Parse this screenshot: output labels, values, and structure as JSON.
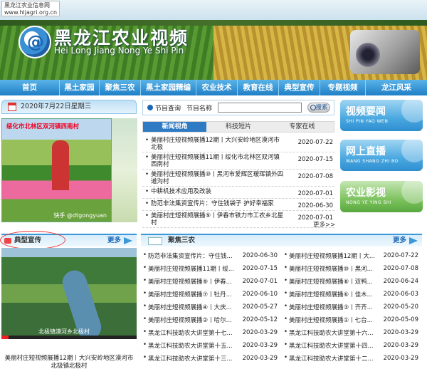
{
  "site": {
    "url_name": "黑龙江农业信息网",
    "url": "www.hljagri.org.cn",
    "logo_glyph": "@",
    "title": "黑龙江农业视频",
    "subtitle": "Hei Long Jiang Nong Ye Shi Pin"
  },
  "nav": [
    "首页",
    "黑土家园",
    "聚焦三农",
    "黑土家园精编",
    "农业技术",
    "教育在线",
    "典型宣传",
    "专题视频",
    "龙江风采"
  ],
  "date_bar": "2020年7月22日星期三",
  "photo1": {
    "caption": "绥化市北林区双河镇西南村",
    "watermark": "快手 @dtgongyuan"
  },
  "search": {
    "radio_label": "节目查询",
    "name_label": "节目名称",
    "value": "",
    "button": "搜索"
  },
  "news_tabs": [
    "新闻视角",
    "科技短片",
    "专家在线"
  ],
  "news": [
    {
      "title": "美丽村庄短视频展播12期丨大兴安岭地区漠河市北极",
      "date": "2020-07-22"
    },
    {
      "title": "美丽村庄短视频展播11期丨绥化市北林区双河镇西南村",
      "date": "2020-07-15"
    },
    {
      "title": "美丽村庄短视频展播⑩丨黑河市爱辉区瑷珲镇外四道沟村",
      "date": "2020-07-08"
    },
    {
      "title": "中耕机技术应用及改装",
      "date": "2020-07-01"
    },
    {
      "title": "防范非法集资宣传片：守住钱袋子 护好幸福家",
      "date": "2020-06-30"
    },
    {
      "title": "美丽村庄短视频展播⑨丨伊春市铁力市工农乡北星村",
      "date": "2020-07-01"
    }
  ],
  "news_more": "更多>>",
  "side_buttons": [
    {
      "big": "视频要闻",
      "small": "SHI PIN YAO WEN"
    },
    {
      "big": "网上直播",
      "small": "WANG SHANG ZHI BO"
    },
    {
      "big": "农业影视",
      "small": "NONG YE YING SHI"
    }
  ],
  "dxxc": {
    "title": "典型宣传",
    "more": "更多"
  },
  "video": {
    "caption": "北极镇漠河乡北极村",
    "title": "美丽村庄短视频展播12期丨大兴安岭地区漠河市北极镇北极村",
    "progress": 0.05
  },
  "jjsn": {
    "title": "聚焦三农",
    "more": "更多"
  },
  "jjsn_left": [
    {
      "title": "防范非法集资宣传片：守住钱...",
      "date": "2020-06-30"
    },
    {
      "title": "美丽村庄短视频展播11期丨绥...",
      "date": "2020-07-15"
    },
    {
      "title": "美丽村庄短视频展播⑨丨伊春...",
      "date": "2020-07-01"
    },
    {
      "title": "美丽村庄短视频展播⑦丨牡丹...",
      "date": "2020-06-10"
    },
    {
      "title": "美丽村庄短视频展播④丨大庆...",
      "date": "2020-05-27"
    },
    {
      "title": "美丽村庄短视频展播②丨哈尔...",
      "date": "2020-05-12"
    },
    {
      "title": "黑龙江科技助农大讲堂第十七...",
      "date": "2020-03-29"
    },
    {
      "title": "黑龙江科技助农大讲堂第十五...",
      "date": "2020-03-29"
    },
    {
      "title": "黑龙江科技助农大讲堂第十三...",
      "date": "2020-03-29"
    }
  ],
  "jjsn_right": [
    {
      "title": "美丽村庄短视频展播12期丨大...",
      "date": "2020-07-22"
    },
    {
      "title": "美丽村庄短视频展播⑩丨黑河...",
      "date": "2020-07-08"
    },
    {
      "title": "美丽村庄短视频展播⑧丨双鸭...",
      "date": "2020-06-24"
    },
    {
      "title": "美丽村庄短视频展播⑥丨佳木...",
      "date": "2020-06-03"
    },
    {
      "title": "美丽村庄短视频展播③丨齐齐...",
      "date": "2020-05-20"
    },
    {
      "title": "美丽村庄短视频展播①丨七台...",
      "date": "2020-05-09"
    },
    {
      "title": "黑龙江科技助农大讲堂第十六...",
      "date": "2020-03-29"
    },
    {
      "title": "黑龙江科技助农大讲堂第十四...",
      "date": "2020-03-29"
    },
    {
      "title": "黑龙江科技助农大讲堂第十二...",
      "date": "2020-03-29"
    }
  ],
  "colors": {
    "nav": "#1f7fc6",
    "accent": "#3c98d8",
    "annotation": "#e33"
  }
}
